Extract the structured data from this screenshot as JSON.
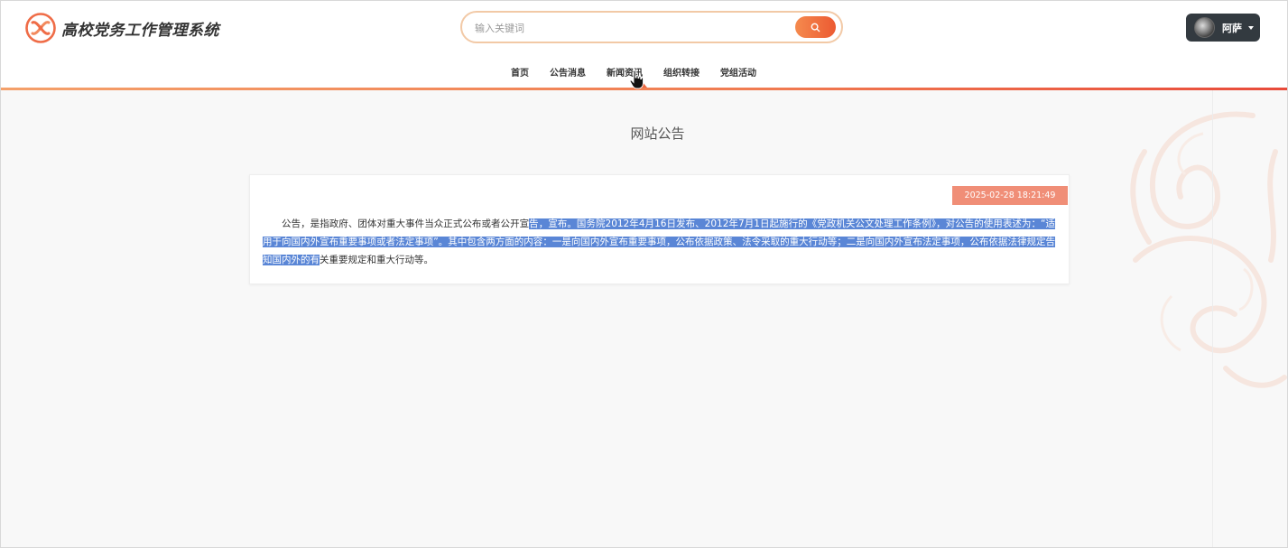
{
  "header": {
    "brand": "高校党务工作管理系统",
    "search_placeholder": "输入关键词",
    "user_name": "阿萨"
  },
  "nav": {
    "items": [
      {
        "label": "首页"
      },
      {
        "label": "公告消息"
      },
      {
        "label": "新闻资讯"
      },
      {
        "label": "组织转接"
      },
      {
        "label": "党组活动"
      }
    ]
  },
  "main": {
    "title": "网站公告",
    "notice": {
      "date": "2025-02-28 18:21:49",
      "text_part1": "公告，是指政府、团体对重大事件当众正式公布或者公开宣",
      "text_selected": "告，宣布。国务院2012年4月16日发布、2012年7月1日起施行的《党政机关公文处理工作条例》，对公告的使用表述为：“适用于向国内外宣布重要事项或者法定事项”。其中包含两方面的内容：一是向国内外宣布重要事项，公布依据政策、法令采取的重大行动等；二是向国内外宣布法定事项，公布依据法律规定告知国内外的有",
      "text_part2": "关重要规定和重大行动等。"
    }
  },
  "colors": {
    "accent": "#ec6a43",
    "date_badge": "#f08e77",
    "user_button": "#333a40",
    "selection": "#5a86d6"
  },
  "icons": {
    "logo": "logo-icon",
    "search": "search-icon",
    "caret": "caret-down-icon",
    "cursor": "hand-cursor-icon"
  }
}
